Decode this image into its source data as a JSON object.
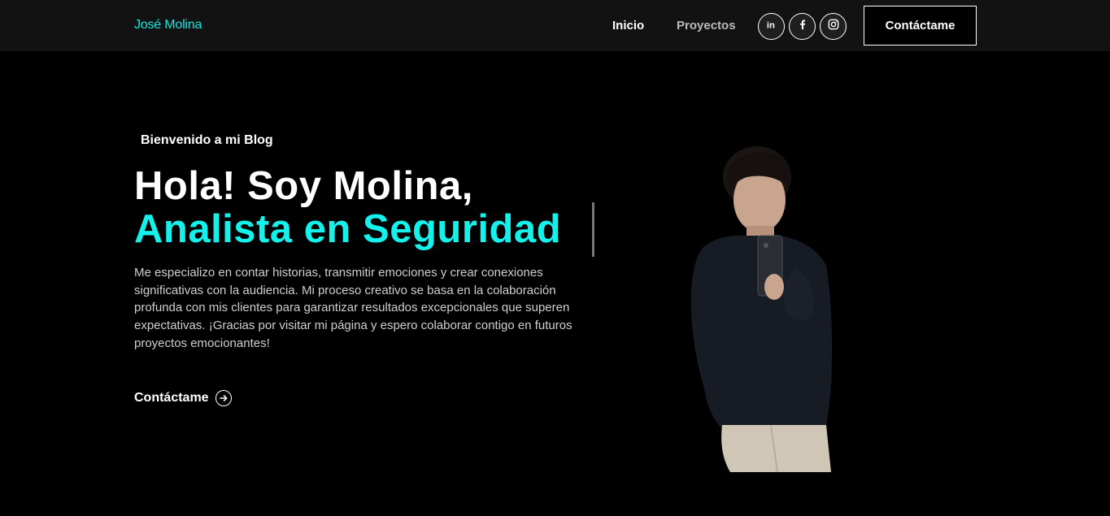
{
  "nav": {
    "logo": "José Molina",
    "links": [
      {
        "label": "Inicio"
      },
      {
        "label": "Proyectos"
      }
    ],
    "social": [
      {
        "icon": "linkedin-icon"
      },
      {
        "icon": "facebook-icon"
      },
      {
        "icon": "instagram-icon"
      }
    ],
    "contact_label": "Contáctame"
  },
  "hero": {
    "tagline": "Bienvenido a mi Blog",
    "headline_line1": "Hola! Soy Molina,",
    "headline_line2": "Analista en Seguridad",
    "description": "Me especializo en contar historias, transmitir emociones y crear conexiones significativas con la audiencia. Mi proceso creativo se basa en la colaboración profunda con mis clientes para garantizar resultados excepcionales que superen expectativas. ¡Gracias por visitar mi página y espero colaborar contigo en futuros proyectos emocionantes!",
    "cta_label": "Contáctame"
  },
  "colors": {
    "background": "#000000",
    "navbar": "#121212",
    "accent": "#14f0ea"
  }
}
